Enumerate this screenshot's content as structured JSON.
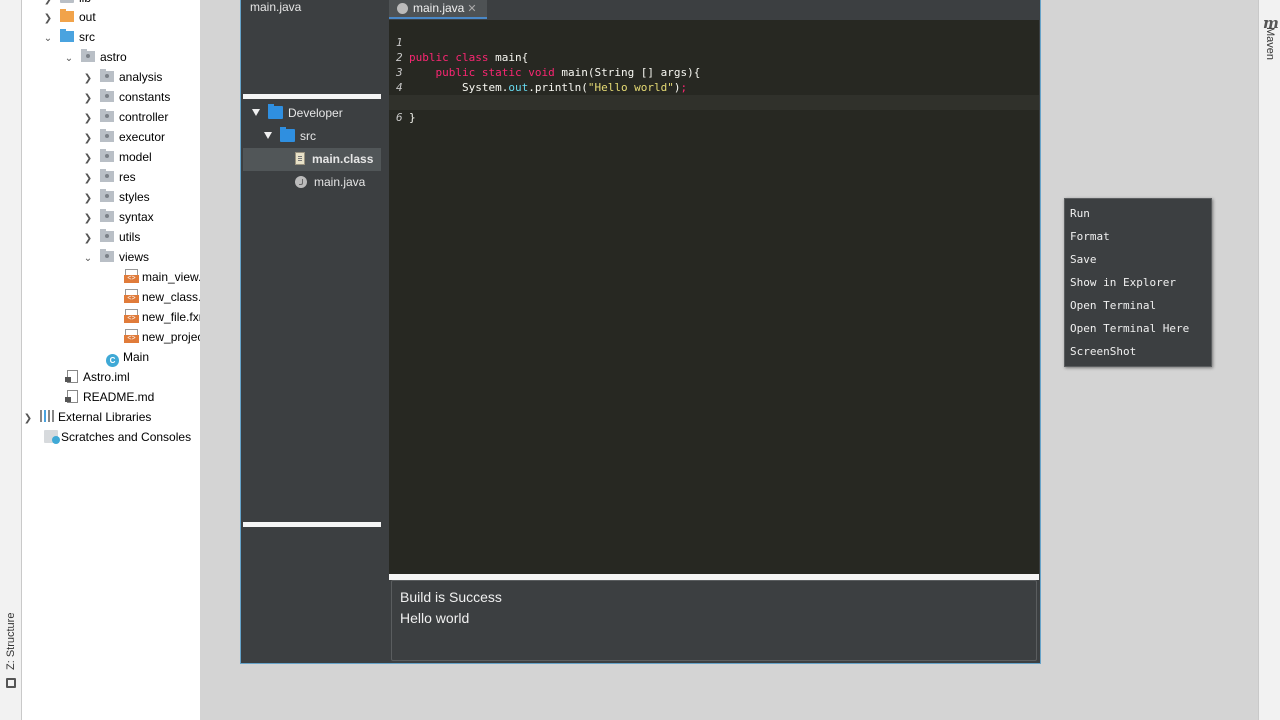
{
  "ide": {
    "structure_tab": "Z: Structure",
    "maven_icon": "m",
    "maven_label": "Maven"
  },
  "project_tree": {
    "items": [
      {
        "label": "out",
        "icon": "folder-orange"
      },
      {
        "label": "src",
        "icon": "folder-blue"
      },
      {
        "label": "astro",
        "icon": "package-folder"
      },
      {
        "label": "analysis",
        "icon": "package-folder"
      },
      {
        "label": "constants",
        "icon": "package-folder"
      },
      {
        "label": "controller",
        "icon": "package-folder"
      },
      {
        "label": "executor",
        "icon": "package-folder"
      },
      {
        "label": "model",
        "icon": "package-folder"
      },
      {
        "label": "res",
        "icon": "package-folder"
      },
      {
        "label": "styles",
        "icon": "package-folder"
      },
      {
        "label": "syntax",
        "icon": "package-folder"
      },
      {
        "label": "utils",
        "icon": "package-folder"
      },
      {
        "label": "views",
        "icon": "package-folder"
      },
      {
        "label": "main_view.",
        "icon": "fxml-file"
      },
      {
        "label": "new_class.f",
        "icon": "fxml-file"
      },
      {
        "label": "new_file.fxr",
        "icon": "fxml-file"
      },
      {
        "label": "new_projec",
        "icon": "fxml-file"
      },
      {
        "label": "Main",
        "icon": "java-class"
      },
      {
        "label": "Astro.iml",
        "icon": "module-file"
      },
      {
        "label": "README.md",
        "icon": "markdown-file"
      },
      {
        "label": "External Libraries",
        "icon": "library"
      },
      {
        "label": "Scratches and Consoles",
        "icon": "scratches"
      }
    ]
  },
  "app": {
    "open_files": [
      "main.java"
    ],
    "project": {
      "root": "Developer",
      "src": "src",
      "files": [
        "main.class",
        "main.java"
      ]
    },
    "editor": {
      "tab_label": "main.java",
      "tab_close": "✕",
      "line_numbers": [
        "1",
        "2",
        "3",
        "4",
        "5",
        "6"
      ],
      "code": {
        "l1_kw": "public class",
        "l1_rest": " main{",
        "l2_indent": "    ",
        "l2_kw": "public static void",
        "l2_rest": " main(String [] args){",
        "l3_indent": "        ",
        "l3_obj": "System.",
        "l3_member": "out",
        "l3_call": ".println(",
        "l3_string": "\"Hello world\"",
        "l3_close": ")",
        "l3_semi": ";",
        "l4": "    }",
        "l5": "}",
        "l6": ""
      }
    },
    "context_menu": [
      "Run",
      "Format",
      "Save",
      "Show in Explorer",
      "Open Terminal",
      "Open Terminal Here",
      "ScreenShot"
    ],
    "console": [
      "Build is Success",
      "Hello world"
    ]
  }
}
